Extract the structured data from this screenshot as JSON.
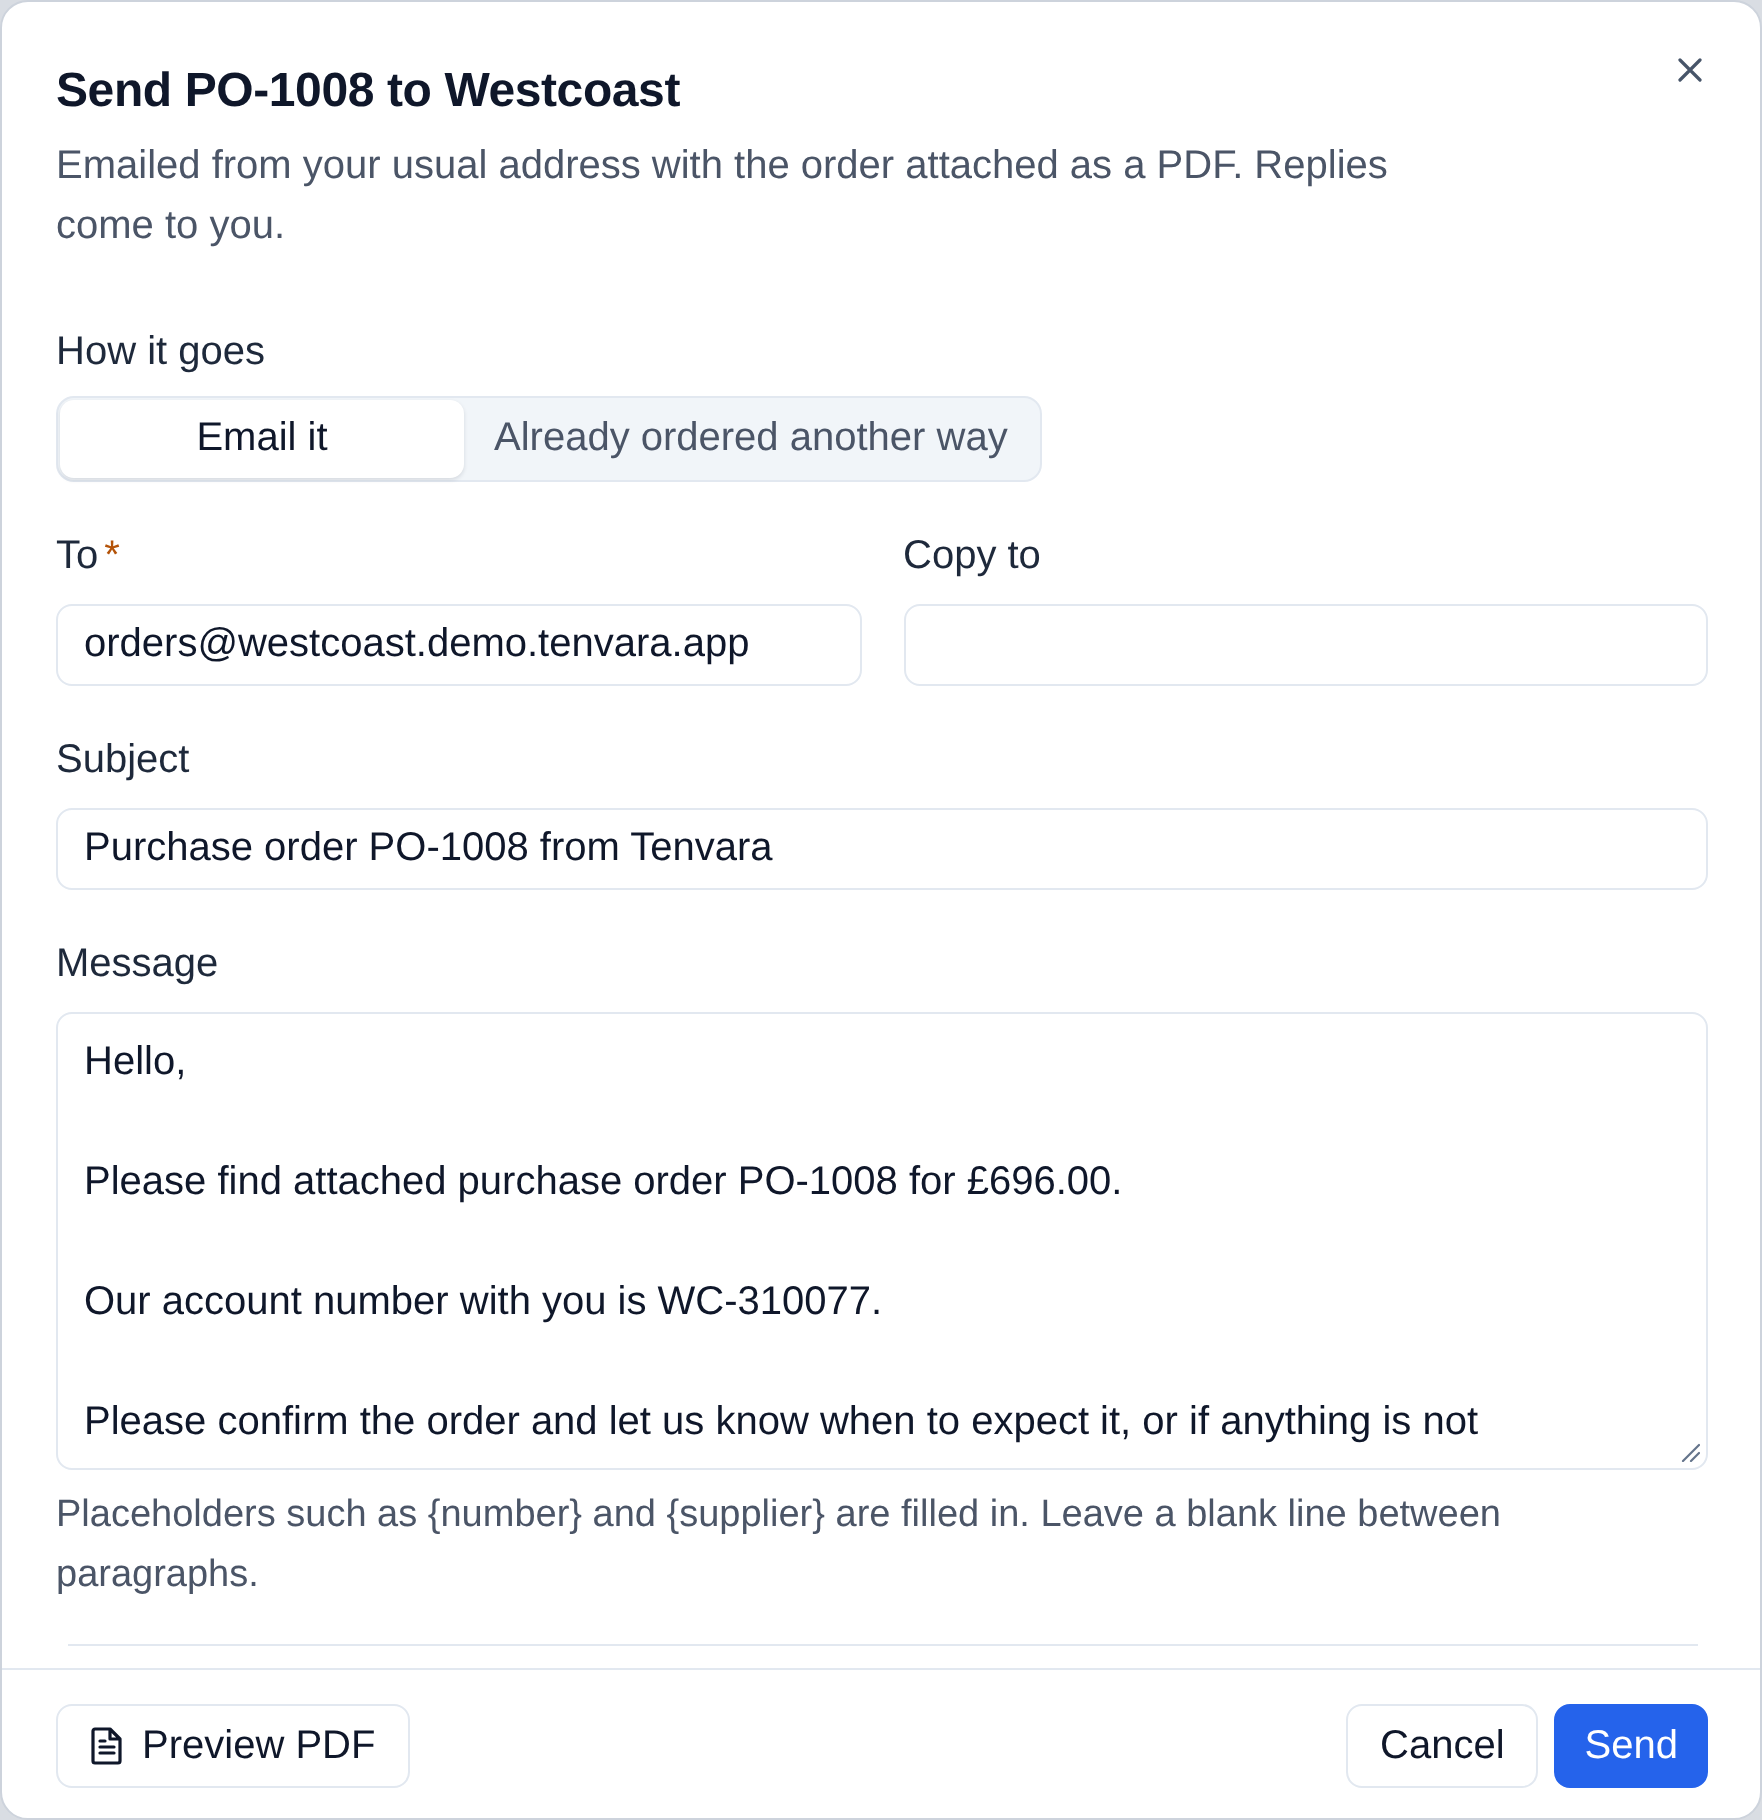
{
  "dialog": {
    "title": "Send PO-1008 to Westcoast",
    "description": "Emailed from your usual address with the order attached as a PDF. Replies come to you."
  },
  "mode": {
    "label": "How it goes",
    "options": [
      {
        "label": "Email it",
        "selected": true
      },
      {
        "label": "Already ordered another way",
        "selected": false
      }
    ]
  },
  "field_rows": [
    [
      {
        "kind": "input",
        "label": "To",
        "required_mark": "*",
        "value": "orders@westcoast.demo.tenvara.app"
      },
      {
        "kind": "input",
        "label": "Copy to"
      }
    ],
    [
      {
        "kind": "input",
        "label": "Subject",
        "value": "Purchase order PO-1008 from Tenvara"
      }
    ],
    [
      {
        "kind": "textarea",
        "label": "Message",
        "value": "Hello,\n\nPlease find attached purchase order PO-1008 for £696.00.\n\nOur account number with you is WC-310077.\n\nPlease confirm the order and let us know when to expect it, or if anything is not"
      }
    ]
  ],
  "hint": "Placeholders such as {number} and {supplier} are filled in. Leave a blank line between paragraphs.",
  "footer": {
    "start": [
      {
        "kind": "document",
        "label": "Preview PDF"
      }
    ],
    "end": [
      {
        "kind": "outline",
        "label": "Cancel"
      },
      {
        "kind": "primary",
        "label": "Send"
      }
    ]
  }
}
